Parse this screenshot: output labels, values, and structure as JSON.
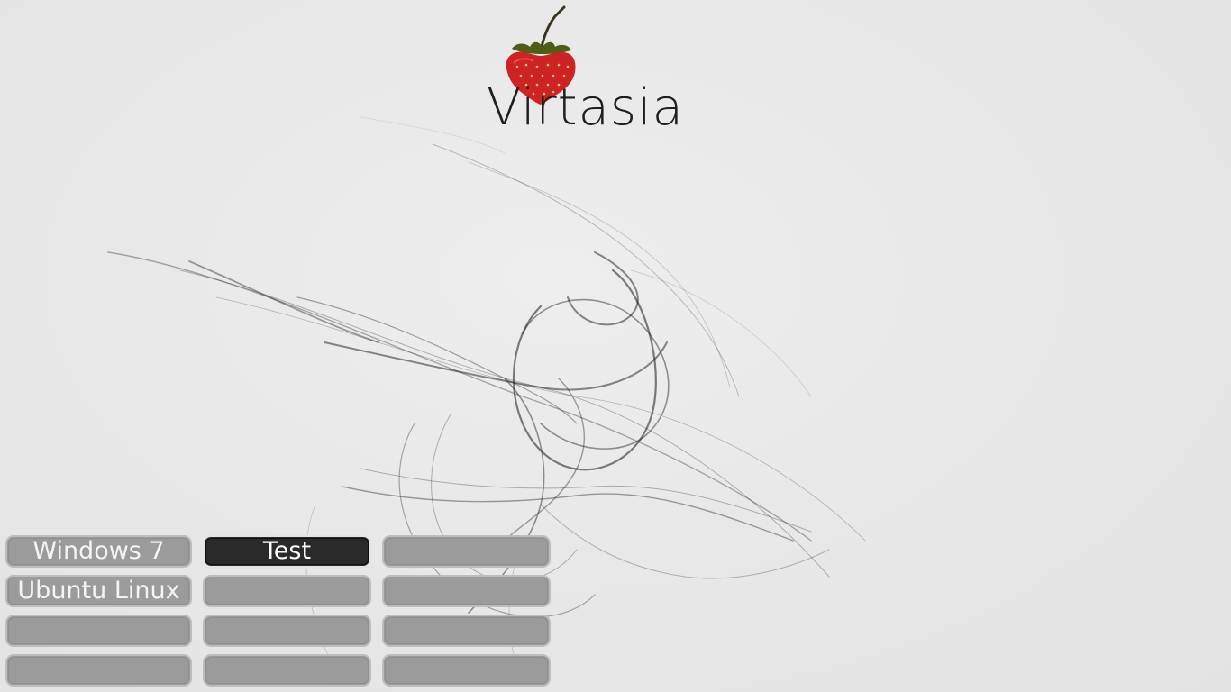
{
  "app": {
    "title": "Virtasia",
    "logo_icon": "strawberry-icon"
  },
  "vm_buttons": [
    {
      "label": "Windows 7",
      "selected": false
    },
    {
      "label": "Test",
      "selected": true
    },
    {
      "label": "",
      "selected": false
    },
    {
      "label": "Ubuntu Linux",
      "selected": false
    },
    {
      "label": "",
      "selected": false
    },
    {
      "label": "",
      "selected": false
    },
    {
      "label": "",
      "selected": false
    },
    {
      "label": "",
      "selected": false
    },
    {
      "label": "",
      "selected": false
    },
    {
      "label": "",
      "selected": false
    },
    {
      "label": "",
      "selected": false
    },
    {
      "label": "",
      "selected": false
    }
  ],
  "colors": {
    "background": "#e6e6e6",
    "button": "#9b9b9b",
    "button_selected": "#2a2a2a",
    "strawberry": "#d42a2a",
    "leaf": "#5a6a1a"
  }
}
